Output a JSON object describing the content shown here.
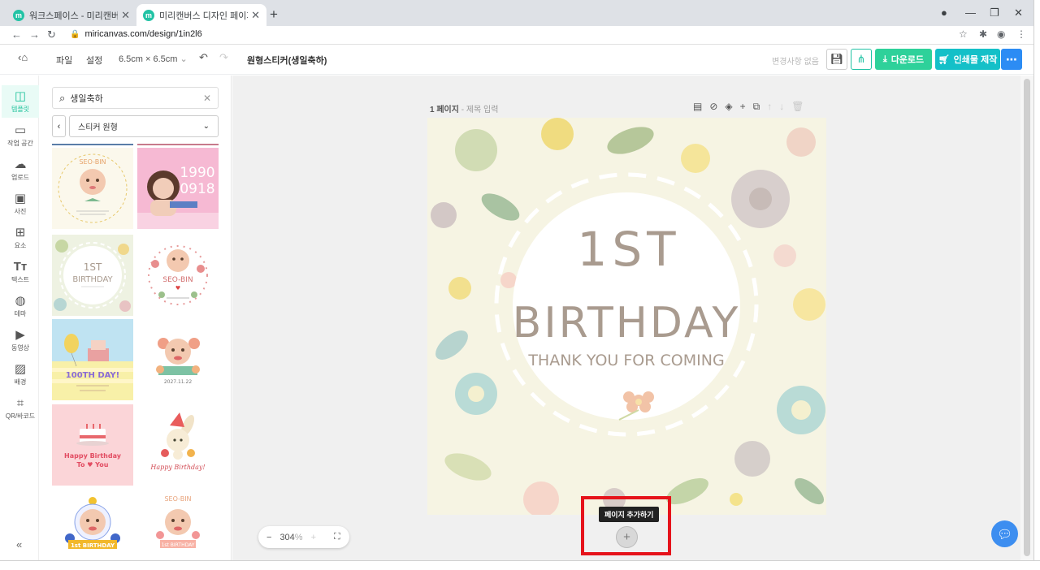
{
  "browser": {
    "tabs": [
      {
        "icon": "m",
        "title": "워크스페이스 - 미리캔버스"
      },
      {
        "icon": "m",
        "title": "미리캔버스 디자인 페이지"
      }
    ],
    "url": "miricanvas.com/design/1in2l6"
  },
  "header": {
    "menu_file": "파일",
    "menu_settings": "설정",
    "size": "6.5cm × 6.5cm",
    "doc_title": "원형스티커(생일축하)",
    "status": "변경사항 없음",
    "download_label": "다운로드",
    "print_label": "인쇄물 제작"
  },
  "rail": {
    "items": [
      {
        "icon": "template-icon",
        "label": "템플릿"
      },
      {
        "icon": "workspace-icon",
        "label": "작업 공간"
      },
      {
        "icon": "upload-icon",
        "label": "업로드"
      },
      {
        "icon": "photo-icon",
        "label": "사진"
      },
      {
        "icon": "elements-icon",
        "label": "요소"
      },
      {
        "icon": "text-icon",
        "label": "텍스트"
      },
      {
        "icon": "theme-icon",
        "label": "테마"
      },
      {
        "icon": "video-icon",
        "label": "동영상"
      },
      {
        "icon": "background-icon",
        "label": "배경"
      },
      {
        "icon": "qr-icon",
        "label": "QR/바코드"
      }
    ]
  },
  "panel": {
    "search_value": "생일축하",
    "category": "스티커 원형",
    "thumbs": [
      {
        "bg": "#fbf8ec",
        "name": "SEO-BIN"
      },
      {
        "bg": "#f6b9d3",
        "name": "1990",
        "line2": "0918"
      },
      {
        "bg": "#eef2e2",
        "line1": "1ST",
        "line2": "BIRTHDAY"
      },
      {
        "bg": "#ffffff",
        "name": "SEO-BIN"
      },
      {
        "bg": "#bfe3f2",
        "line1": "100TH DAY!"
      },
      {
        "bg": "#ffffff",
        "line1": "2027.11.22"
      },
      {
        "bg": "#fbd5d8",
        "line1": "Happy Birthday",
        "line2": "To ♥ You"
      },
      {
        "bg": "#ffffff",
        "line1": "Happy Birthday!"
      },
      {
        "bg": "#ffffff",
        "line1": "1st BIRTHDAY"
      },
      {
        "bg": "#ffffff",
        "name": "SEO-BIN",
        "line1": "1st BIRTHDAY"
      }
    ]
  },
  "canvas": {
    "page_label": "1 페이지",
    "page_sub": "- 제목 입력",
    "title_line1": "1ST",
    "title_line2": "BIRTHDAY",
    "title_line3": "THANK YOU FOR COMING",
    "zoom": "304",
    "zoom_unit": "%",
    "tooltip": "페이지 추가하기"
  },
  "colors": {
    "brand": "#22c3a5",
    "highlight": "#e6131b",
    "title_text": "#a99b8f"
  }
}
